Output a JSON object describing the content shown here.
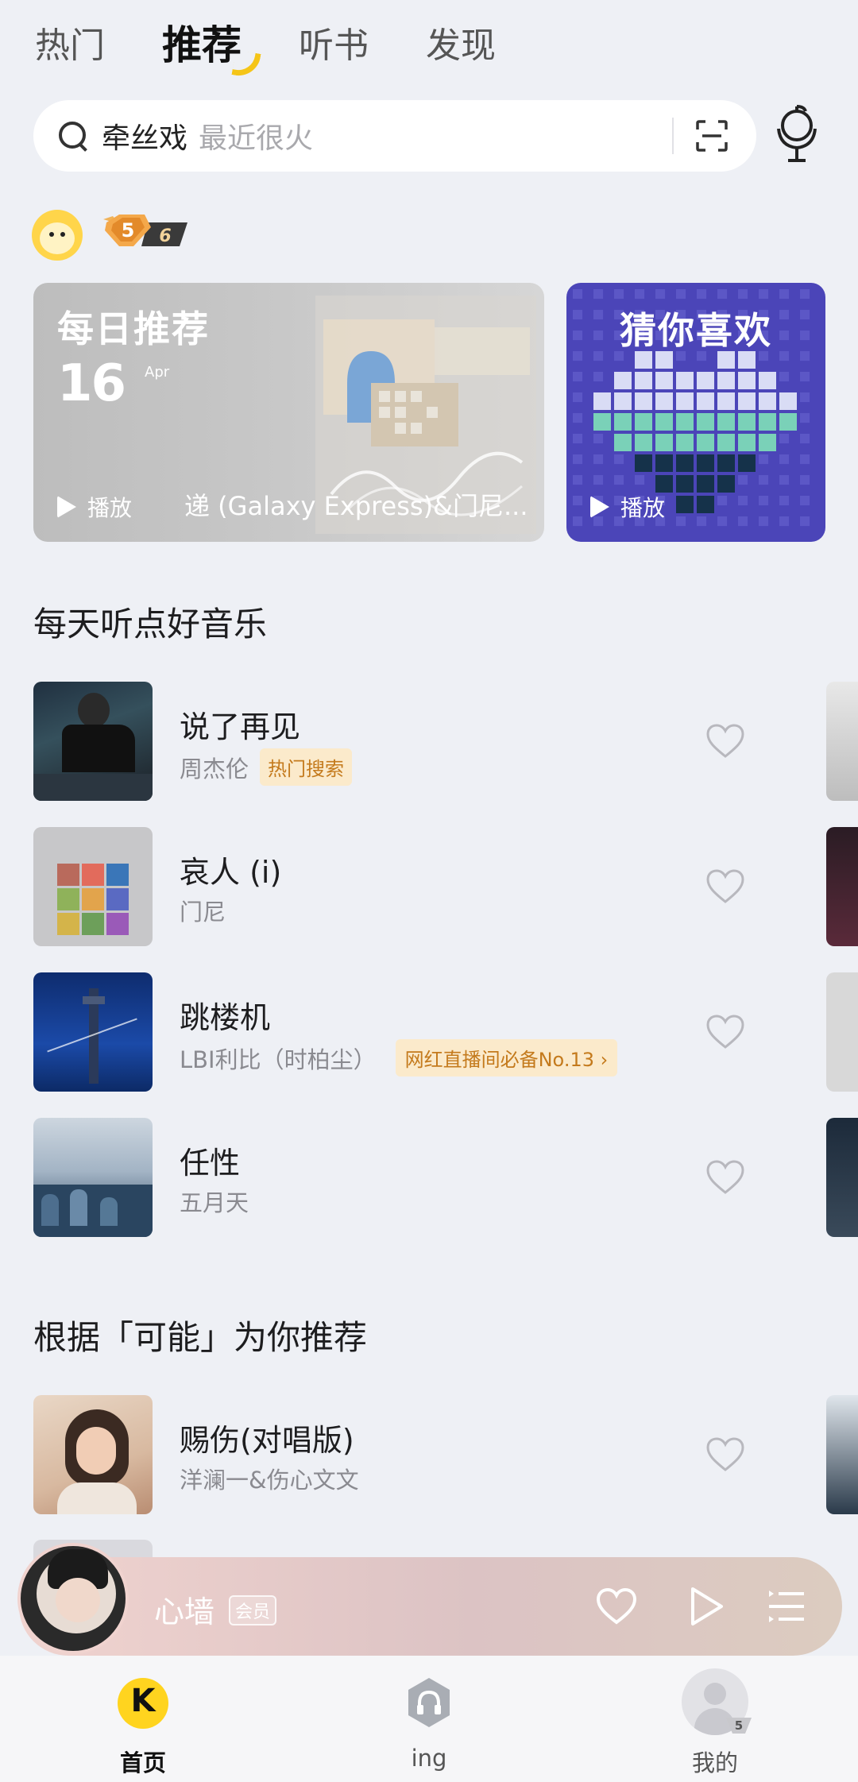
{
  "top_tabs": [
    {
      "label": "热门"
    },
    {
      "label": "推荐",
      "active": true
    },
    {
      "label": "听书"
    },
    {
      "label": "发现"
    }
  ],
  "search": {
    "hint_main": "牵丝戏",
    "hint_sub": "最近很火"
  },
  "user": {
    "level": "5",
    "badge_number": "6"
  },
  "daily_card": {
    "title": "每日推荐",
    "day": "16",
    "month": "Apr",
    "play_label": "播放",
    "now_text": "递 (Galaxy Express)&门尼..."
  },
  "guess_card": {
    "title": "猜你喜欢",
    "play_label": "播放"
  },
  "section1": {
    "title": "每天听点好音乐",
    "songs": [
      {
        "name": "说了再见",
        "artist": "周杰伦",
        "tag": "热门搜索"
      },
      {
        "name": "哀人 (i)",
        "artist": "门尼",
        "tag": ""
      },
      {
        "name": "跳楼机",
        "artist": "LBI利比（时柏尘）",
        "tag": "网红直播间必备No.13 ›"
      },
      {
        "name": "任性",
        "artist": "五月天",
        "tag": ""
      }
    ]
  },
  "section2": {
    "title": "根据「可能」为你推荐",
    "songs": [
      {
        "name": "赐伤(对唱版)",
        "artist": "洋澜一&伤心文文"
      }
    ]
  },
  "player": {
    "song": "心墙",
    "vip": "会员"
  },
  "bottom_nav": [
    {
      "label": "首页",
      "active": true
    },
    {
      "label": "ing"
    },
    {
      "label": "我的"
    }
  ],
  "colors": {
    "accent": "#f5c518",
    "card_purple": "#4b45b8",
    "tag_bg": "#fbeacb",
    "tag_text": "#c47a1c"
  }
}
